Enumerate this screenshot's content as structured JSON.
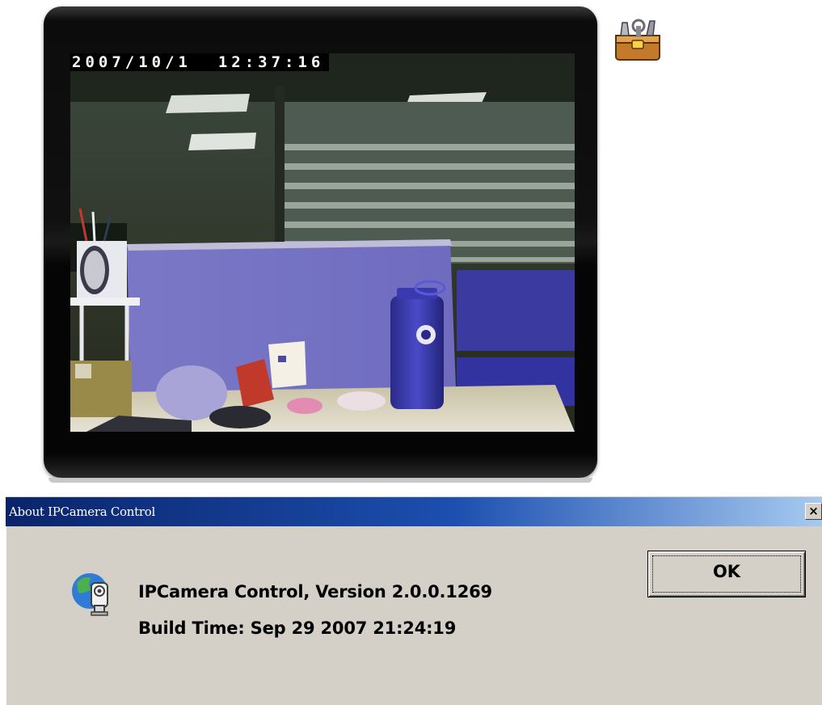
{
  "camera_view": {
    "timestamp": "2007/10/1  12:37:16",
    "toolbox_icon": "toolbox-icon"
  },
  "about_dialog": {
    "title": "About IPCamera Control",
    "close_label": "×",
    "app_icon": "ipcamera-globe-icon",
    "version_text": "IPCamera Control, Version 2.0.0.1269",
    "build_text": "Build Time: Sep 29 2007  21:24:19",
    "ok_label": "OK"
  },
  "colors": {
    "title_bar_start": "#0a246a",
    "title_bar_end": "#a6caf0",
    "dialog_face": "#d4d0c8"
  }
}
